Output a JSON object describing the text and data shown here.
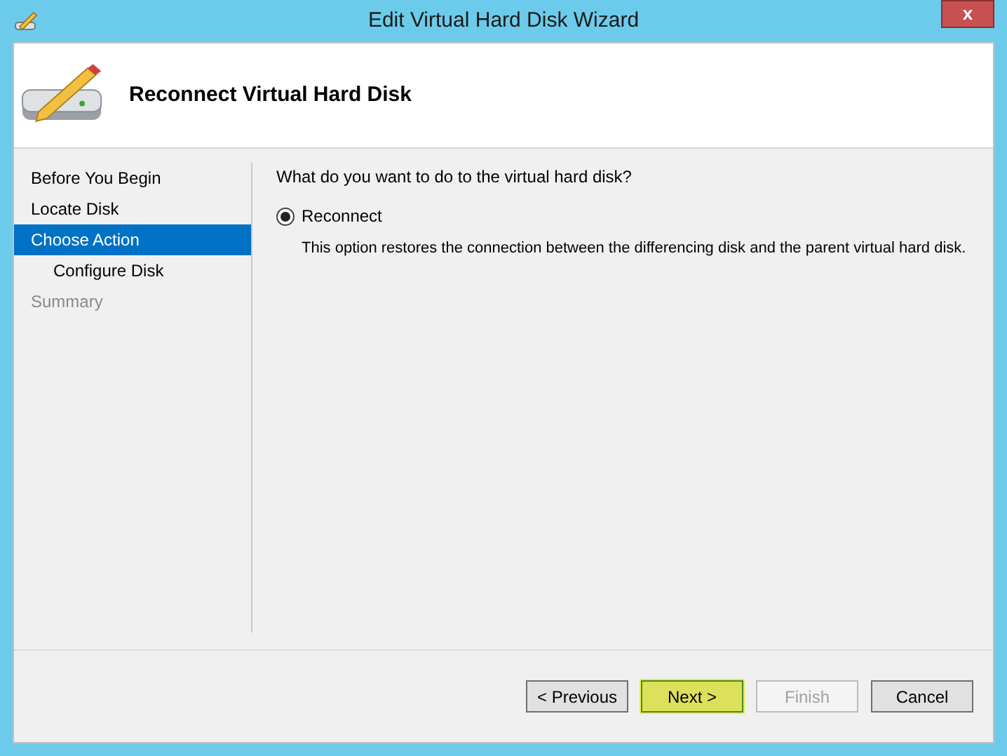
{
  "window": {
    "title": "Edit Virtual Hard Disk Wizard",
    "close": "x"
  },
  "header": {
    "title": "Reconnect Virtual Hard Disk"
  },
  "steps": [
    {
      "label": "Before You Begin",
      "selected": false,
      "disabled": false
    },
    {
      "label": "Locate Disk",
      "selected": false,
      "disabled": false
    },
    {
      "label": "Choose Action",
      "selected": true,
      "disabled": false,
      "children": [
        {
          "label": "Configure Disk",
          "selected": false,
          "disabled": false
        }
      ]
    },
    {
      "label": "Summary",
      "selected": false,
      "disabled": true
    }
  ],
  "question": "What do you want to do to the virtual hard disk?",
  "options": [
    {
      "label": "Reconnect",
      "selected": true,
      "description": "This option restores the connection between the differencing disk and the parent virtual hard disk."
    }
  ],
  "buttons": [
    {
      "label": "< Previous",
      "disabled": false,
      "focused": false
    },
    {
      "label": "Next >",
      "disabled": false,
      "focused": true
    },
    {
      "label": "Finish",
      "disabled": true,
      "focused": false
    },
    {
      "label": "Cancel",
      "disabled": false,
      "focused": false
    }
  ]
}
